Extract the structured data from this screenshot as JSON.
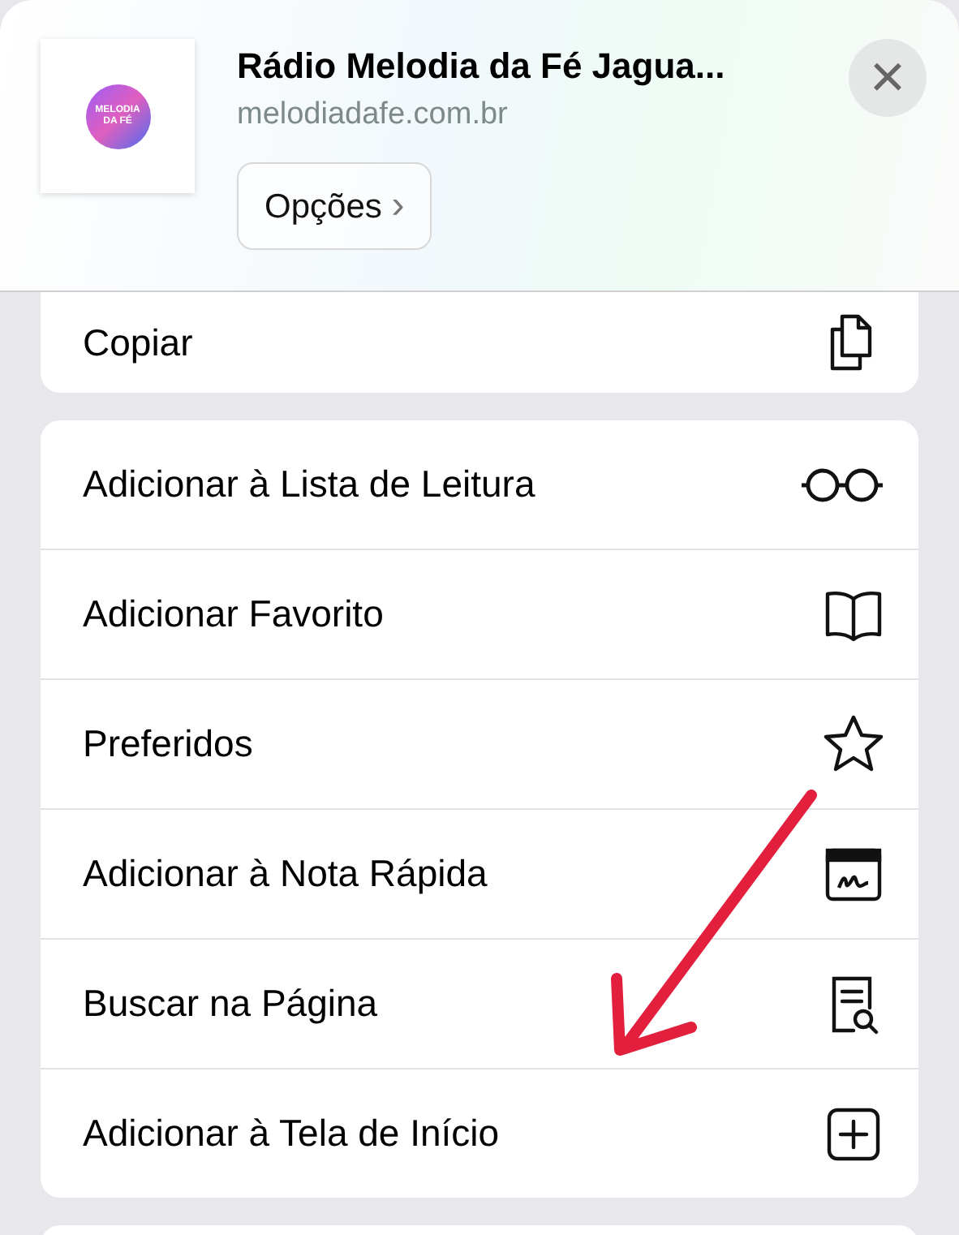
{
  "header": {
    "title": "Rádio Melodia da Fé Jagua...",
    "url": "melodiadafe.com.br",
    "logo_lines": [
      "MELODIA",
      "DA FÉ"
    ],
    "options_button": "Opções",
    "options_chevron": "›",
    "close": "×"
  },
  "groups": [
    [
      {
        "label": "Copiar",
        "kind": "copy"
      }
    ],
    [
      {
        "label": "Adicionar à Lista de Leitura",
        "kind": "reading_list"
      },
      {
        "label": "Adicionar Favorito",
        "kind": "bookmark"
      },
      {
        "label": "Preferidos",
        "kind": "favorites"
      },
      {
        "label": "Adicionar à Nota Rápida",
        "kind": "quick_note"
      },
      {
        "label": "Buscar na Página",
        "kind": "find"
      },
      {
        "label": "Adicionar à Tela de Início",
        "kind": "home_screen"
      }
    ]
  ],
  "annotations": [
    {
      "kind": "arrow"
    }
  ]
}
